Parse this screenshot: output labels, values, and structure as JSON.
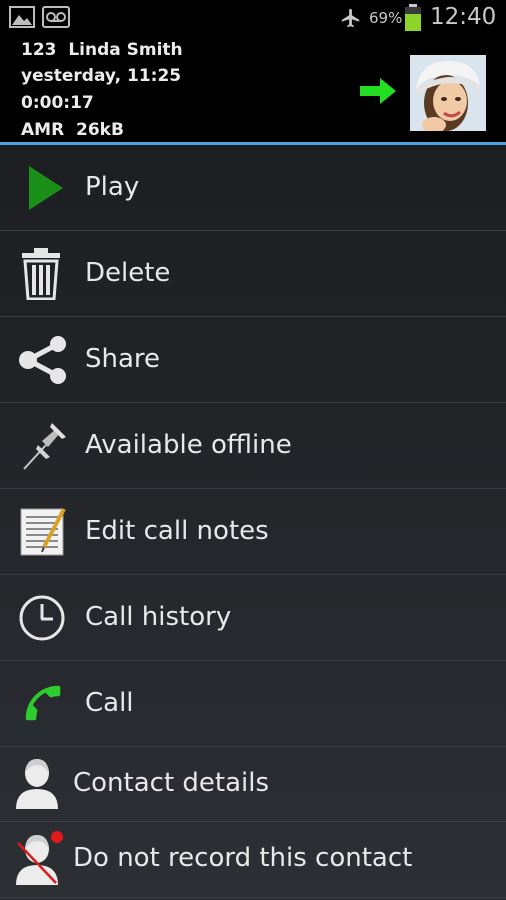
{
  "status_bar": {
    "battery_percent": "69%",
    "time": "12:40",
    "icons": [
      "gallery-icon",
      "voicemail-icon",
      "airplane-mode-icon",
      "battery-icon"
    ]
  },
  "recording": {
    "title": "123  Linda Smith",
    "date": "yesterday, 11:25",
    "duration": "0:00:17",
    "format": "AMR  26kB",
    "direction_icon": "outgoing-arrow-icon",
    "avatar": "contact-photo"
  },
  "colors": {
    "accent": "#4aa3df",
    "play_green": "#1a8f1a",
    "call_green": "#2ecc2e",
    "arrow_green": "#22dd22",
    "record_red": "#e01a1a"
  },
  "menu": {
    "items": [
      {
        "label": "Play",
        "icon": "play-icon"
      },
      {
        "label": "Delete",
        "icon": "trash-icon"
      },
      {
        "label": "Share",
        "icon": "share-icon"
      },
      {
        "label": "Available offline",
        "icon": "pin-icon"
      },
      {
        "label": "Edit call notes",
        "icon": "notepad-icon"
      },
      {
        "label": "Call history",
        "icon": "clock-icon"
      },
      {
        "label": "Call",
        "icon": "phone-icon"
      },
      {
        "label": "Contact details",
        "icon": "person-icon"
      },
      {
        "label": "Do not record this contact",
        "icon": "person-no-record-icon"
      }
    ]
  }
}
